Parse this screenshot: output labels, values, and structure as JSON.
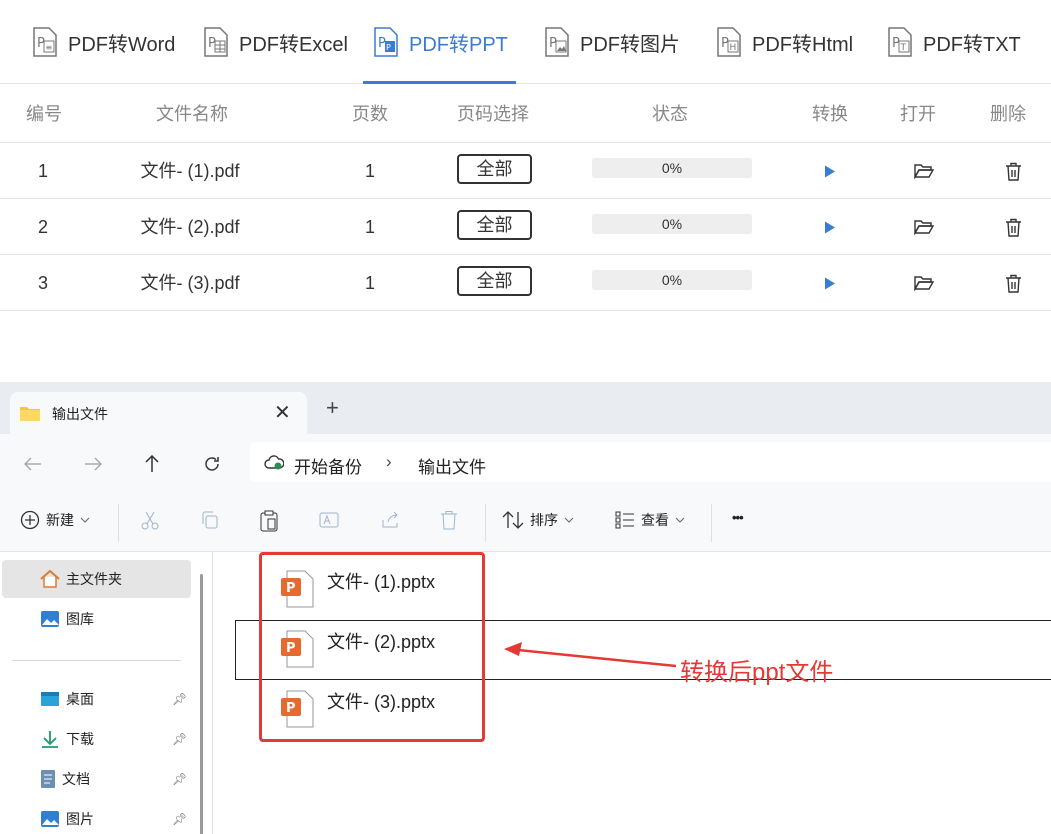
{
  "tabs": [
    {
      "label": "PDF转Word",
      "icon": "pdf-word-icon",
      "active": false
    },
    {
      "label": "PDF转Excel",
      "icon": "pdf-excel-icon",
      "active": false
    },
    {
      "label": "PDF转PPT",
      "icon": "pdf-ppt-icon",
      "active": true
    },
    {
      "label": "PDF转图片",
      "icon": "pdf-image-icon",
      "active": false
    },
    {
      "label": "PDF转Html",
      "icon": "pdf-html-icon",
      "active": false
    },
    {
      "label": "PDF转TXT",
      "icon": "pdf-txt-icon",
      "active": false
    }
  ],
  "table": {
    "headers": [
      "编号",
      "文件名称",
      "页数",
      "页码选择",
      "状态",
      "转换",
      "打开",
      "删除"
    ],
    "rows": [
      {
        "num": "1",
        "name": "文件- (1).pdf",
        "pages": "1",
        "range": "全部",
        "status": "0%"
      },
      {
        "num": "2",
        "name": "文件- (2).pdf",
        "pages": "1",
        "range": "全部",
        "status": "0%"
      },
      {
        "num": "3",
        "name": "文件- (3).pdf",
        "pages": "1",
        "range": "全部",
        "status": "0%"
      }
    ]
  },
  "explorer": {
    "tab_title": "输出文件",
    "close_symbol": "✕",
    "newtab_symbol": "+",
    "breadcrumb": [
      "开始备份",
      "输出文件"
    ],
    "breadcrumb_sep": "›",
    "toolbar": {
      "new": "新建",
      "sort": "排序",
      "view": "查看",
      "more": "•••"
    },
    "sidebar": [
      {
        "label": "主文件夹",
        "icon": "home-icon"
      },
      {
        "label": "图库",
        "icon": "gallery-icon"
      },
      {
        "label": "桌面",
        "icon": "desktop-icon"
      },
      {
        "label": "下载",
        "icon": "download-icon"
      },
      {
        "label": "文档",
        "icon": "document-icon"
      },
      {
        "label": "图片",
        "icon": "pictures-icon"
      }
    ],
    "files": [
      "文件- (1).pptx",
      "文件- (2).pptx",
      "文件- (3).pptx"
    ]
  },
  "annotation": "转换后ppt文件",
  "colors": {
    "accent": "#3b7bd4",
    "annotation": "#e53935",
    "ppt": "#e8692d"
  }
}
